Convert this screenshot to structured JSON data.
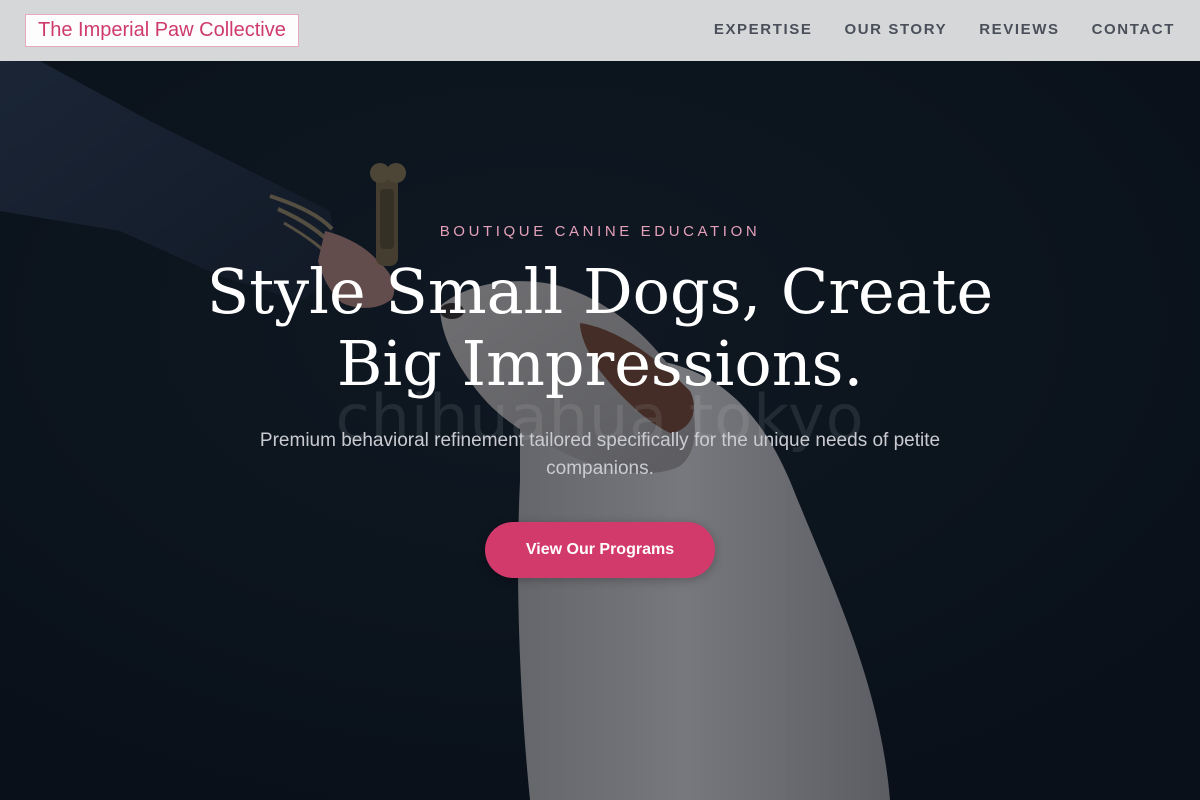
{
  "header": {
    "brand": "The Imperial Paw Collective",
    "nav": [
      "EXPERTISE",
      "OUR STORY",
      "REVIEWS",
      "CONTACT"
    ]
  },
  "hero": {
    "eyebrow": "BOUTIQUE CANINE EDUCATION",
    "title_line1": "Style Small Dogs, Create",
    "title_line2": "Big Impressions.",
    "subtitle": "Premium behavioral refinement tailored specifically for the unique needs of petite companions.",
    "watermark": "chihuahua tokyo",
    "cta_label": "View Our Programs"
  },
  "colors": {
    "accent": "#d33a6c",
    "brand_text": "#cf3a6e",
    "eyebrow": "#e4a0b9",
    "header_bg": "#d6d7d9",
    "hero_bg": "#0c1520"
  },
  "images": {
    "hero_photo": "hand-holding-bone-treat-and-white-dog-photo"
  }
}
